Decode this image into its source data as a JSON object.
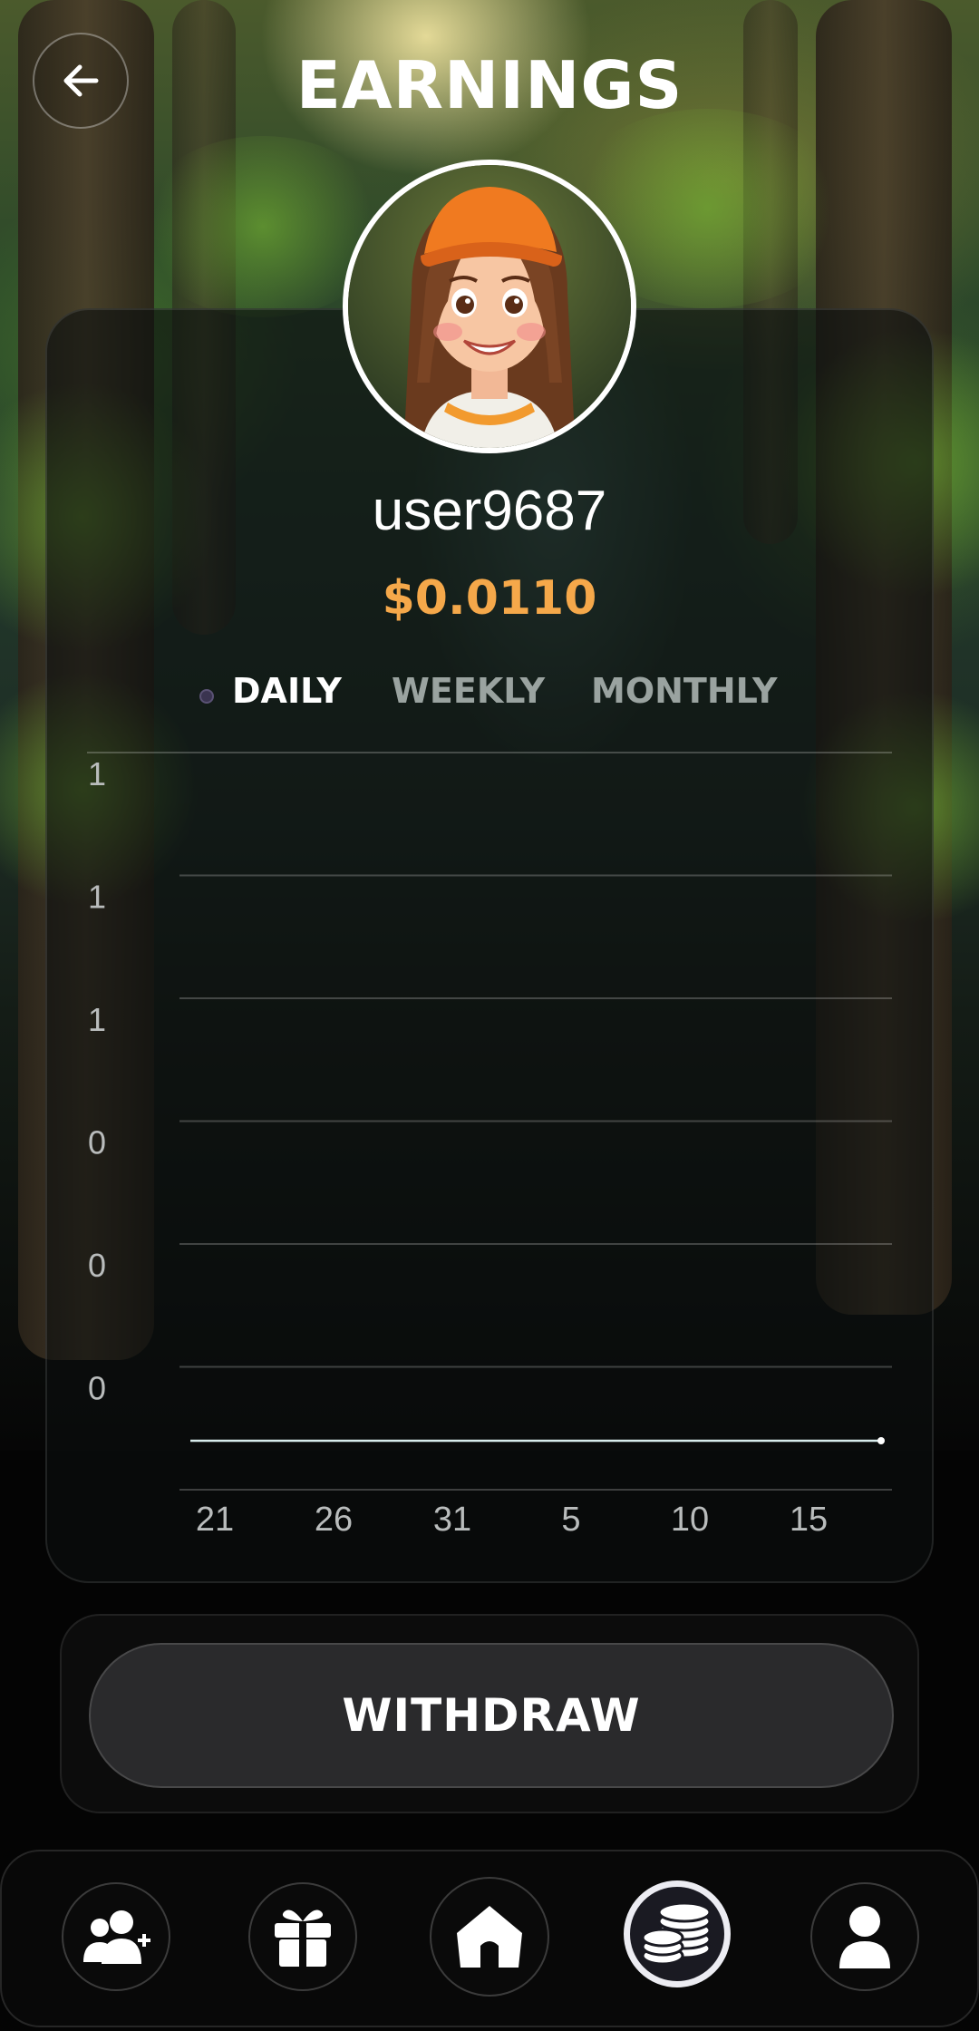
{
  "header": {
    "title": "EARNINGS"
  },
  "profile": {
    "username": "user9687",
    "balance": "$0.0110"
  },
  "tabs": [
    {
      "label": "DAILY",
      "active": true
    },
    {
      "label": "WEEKLY",
      "active": false
    },
    {
      "label": "MONTHLY",
      "active": false
    }
  ],
  "chart_data": {
    "type": "line",
    "y_tick_labels": [
      "1",
      "1",
      "1",
      "0",
      "0",
      "0"
    ],
    "x_tick_labels": [
      "21",
      "26",
      "31",
      "5",
      "10",
      "15"
    ],
    "series": [
      {
        "values": [
          0,
          0,
          0,
          0,
          0,
          0,
          0
        ]
      }
    ],
    "grid": true,
    "line_color": "#d8ecec"
  },
  "actions": {
    "withdraw_label": "WITHDRAW"
  },
  "nav": [
    {
      "icon": "add-friend-icon",
      "active": false
    },
    {
      "icon": "gift-icon",
      "active": false
    },
    {
      "icon": "home-icon",
      "active": false
    },
    {
      "icon": "coins-icon",
      "active": true
    },
    {
      "icon": "profile-icon",
      "active": false
    }
  ],
  "colors": {
    "accent": "#f5a84a",
    "tab_inactive": "#9aa3a0"
  }
}
